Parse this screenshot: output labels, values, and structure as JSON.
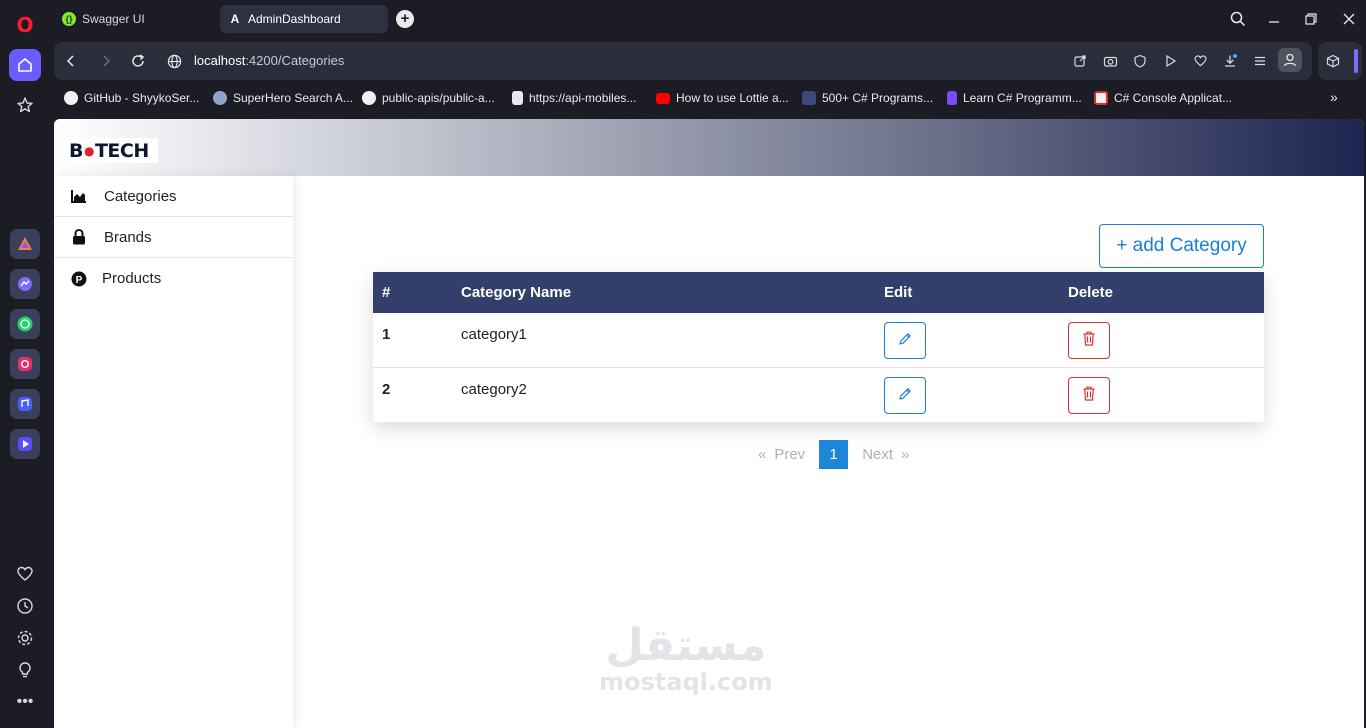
{
  "browser": {
    "tabs": [
      {
        "title": "Swagger UI",
        "favicon": "swagger-icon"
      },
      {
        "title": "AdminDashboard",
        "favicon": "angular-icon"
      }
    ],
    "url": {
      "host": "localhost",
      "path": ":4200/Categories"
    },
    "bookmarks": [
      {
        "label": "GitHub - ShyykoSer...",
        "icon": "github-icon"
      },
      {
        "label": "SuperHero Search A...",
        "icon": "superhero-icon"
      },
      {
        "label": "public-apis/public-a...",
        "icon": "github-icon"
      },
      {
        "label": "https://api-mobiles...",
        "icon": "file-icon"
      },
      {
        "label": "How to use Lottie a...",
        "icon": "youtube-icon"
      },
      {
        "label": "500+ C# Programs...",
        "icon": "site-icon"
      },
      {
        "label": "Learn C# Programm...",
        "icon": "p-icon"
      },
      {
        "label": "C# Console Applicat...",
        "icon": "csharp-icon"
      }
    ]
  },
  "app": {
    "logo_text_1": "B",
    "logo_dot": "●",
    "logo_text_2": "TECH",
    "nav": [
      {
        "label": "Categories",
        "icon": "chart-icon"
      },
      {
        "label": "Brands",
        "icon": "lock-icon"
      },
      {
        "label": "Products",
        "icon": "product-p-icon"
      }
    ],
    "add_button": "+ add Category",
    "table": {
      "headers": [
        "#",
        "Category Name",
        "Edit",
        "Delete"
      ],
      "rows": [
        {
          "num": "1",
          "name": "category1"
        },
        {
          "num": "2",
          "name": "category2"
        }
      ]
    },
    "pager": {
      "first": "«",
      "prev": "Prev",
      "current": "1",
      "next": "Next",
      "last": "»"
    }
  },
  "watermark": {
    "arabic": "مستقل",
    "latin": "mostaql.com"
  },
  "colors": {
    "primary": "#1c7ed6",
    "danger": "#d63333",
    "table_header": "#333f6b",
    "opera_accent": "#6b5cff"
  }
}
